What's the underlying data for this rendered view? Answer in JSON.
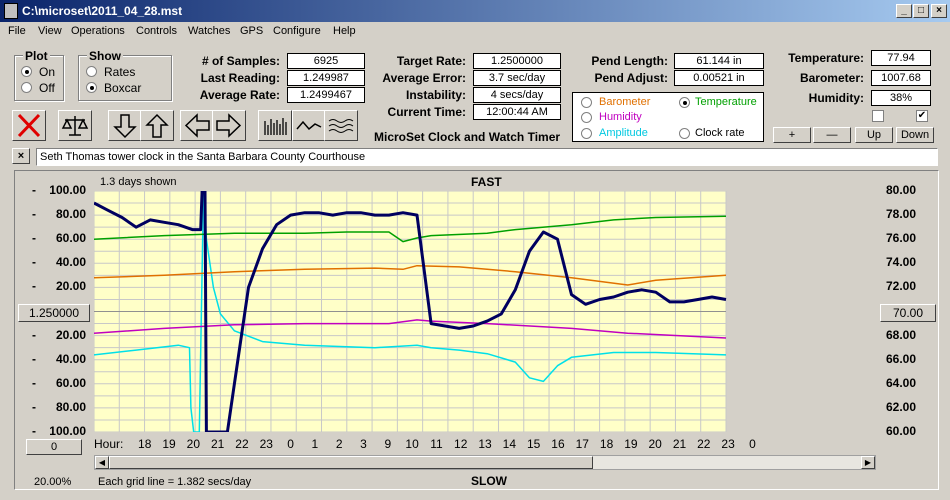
{
  "window": {
    "title": "C:\\microset\\2011_04_28.mst",
    "minimize": "_",
    "maximize": "□",
    "close": "×"
  },
  "menu": [
    "File",
    "View",
    "Operations",
    "Controls",
    "Watches",
    "GPS",
    "Configure",
    "Help"
  ],
  "plot_group": {
    "title": "Plot",
    "on": "On",
    "off": "Off",
    "selected": "On"
  },
  "show_group": {
    "title": "Show",
    "rates": "Rates",
    "boxcar": "Boxcar",
    "selected": "Boxcar"
  },
  "stats": {
    "samples_label": "# of Samples:",
    "samples": "6925",
    "last_label": "Last Reading:",
    "last": "1.249987",
    "avg_label": "Average Rate:",
    "avg": "1.2499467",
    "target_label": "Target Rate:",
    "target": "1.2500000",
    "error_label": "Average Error:",
    "error": "3.7 sec/day",
    "instab_label": "Instability:",
    "instab": "4 secs/day",
    "time_label": "Current Time:",
    "time": "12:00:44 AM",
    "pend_len_label": "Pend Length:",
    "pend_len": "61.144 in",
    "pend_adj_label": "Pend Adjust:",
    "pend_adj": "0.00521 in",
    "temp_label": "Temperature:",
    "temp": "77.94",
    "baro_label": "Barometer:",
    "baro": "1007.68",
    "hum_label": "Humidity:",
    "hum": "38%"
  },
  "app_name": "MicroSet Clock and Watch Timer",
  "legend": {
    "barometer": {
      "label": "Barometer",
      "color": "#e07000"
    },
    "temperature": {
      "label": "Temperature",
      "color": "#00a000",
      "selected": true
    },
    "humidity": {
      "label": "Humidity",
      "color": "#c000c0"
    },
    "amplitude": {
      "label": "Amplitude",
      "color": "#00c8e0"
    },
    "clock_rate": {
      "label": "Clock rate",
      "color": "#000000"
    }
  },
  "scale_buttons": {
    "plus": "+",
    "minus": "—",
    "up": "Up",
    "down": "Down"
  },
  "description_close": "×",
  "description": "Seth Thomas tower clock in the Santa Barbara County Courthouse",
  "chart_header": {
    "days_shown": "1.3 days shown",
    "fast": "FAST",
    "slow": "SLOW"
  },
  "center_left_button": "1.250000",
  "center_right_button": "70.00",
  "zero_button": "0",
  "hour_label": "Hour:",
  "footer": {
    "zoom": "20.00%",
    "grid_note": "Each grid line = 1.382 secs/day"
  },
  "chart_data": {
    "type": "line",
    "x_unit": "hour",
    "x_ticks": [
      "18",
      "19",
      "20",
      "21",
      "22",
      "23",
      "0",
      "1",
      "2",
      "3",
      "9",
      "10",
      "11",
      "12",
      "13",
      "14",
      "15",
      "16",
      "17",
      "18",
      "19",
      "20",
      "21",
      "22",
      "23",
      "0"
    ],
    "left_axis": {
      "ticks": [
        "100.00",
        "80.00",
        "60.00",
        "40.00",
        "20.00",
        "",
        "20.00",
        "40.00",
        "60.00",
        "80.00",
        "100.00"
      ],
      "ylim": [
        -100,
        100
      ]
    },
    "right_axis": {
      "ticks": [
        "80.00",
        "78.00",
        "76.00",
        "74.00",
        "72.00",
        "70.00",
        "68.00",
        "66.00",
        "64.00",
        "62.00",
        "60.00"
      ],
      "ylim": [
        60,
        80
      ]
    },
    "grid": true,
    "series": [
      {
        "key": "clock_rate",
        "color": "#000060",
        "values": [
          [
            0,
            90
          ],
          [
            1,
            84
          ],
          [
            2,
            78
          ],
          [
            3,
            70
          ],
          [
            4,
            76
          ],
          [
            5,
            74
          ],
          [
            6,
            72
          ],
          [
            7,
            68
          ],
          [
            7.6,
            68
          ],
          [
            7.7,
            100
          ],
          [
            7.9,
            100
          ],
          [
            8.0,
            -100
          ],
          [
            8.5,
            -100
          ],
          [
            9,
            -100
          ],
          [
            9.5,
            -100
          ],
          [
            10,
            -60
          ],
          [
            11,
            20
          ],
          [
            12,
            52
          ],
          [
            13,
            72
          ],
          [
            14,
            80
          ],
          [
            15,
            82
          ],
          [
            16,
            82
          ],
          [
            17,
            80
          ],
          [
            18,
            82
          ],
          [
            19,
            82
          ],
          [
            20,
            80
          ],
          [
            21,
            80
          ],
          [
            22,
            82
          ],
          [
            23,
            80
          ],
          [
            24,
            -10
          ],
          [
            25,
            -12
          ],
          [
            26,
            -14
          ],
          [
            27,
            -12
          ],
          [
            28,
            -8
          ],
          [
            29,
            -2
          ],
          [
            30,
            18
          ],
          [
            31,
            50
          ],
          [
            32,
            66
          ],
          [
            33,
            60
          ],
          [
            34,
            14
          ],
          [
            35,
            6
          ],
          [
            36,
            10
          ],
          [
            37,
            12
          ],
          [
            38,
            16
          ],
          [
            39,
            18
          ],
          [
            40,
            16
          ],
          [
            41,
            8
          ],
          [
            42,
            8
          ],
          [
            43,
            10
          ],
          [
            44,
            12
          ],
          [
            45,
            10
          ]
        ]
      },
      {
        "key": "temperature",
        "color": "#00a000",
        "values": [
          [
            0,
            76.0
          ],
          [
            5,
            76.3
          ],
          [
            10,
            76.5
          ],
          [
            15,
            76.5
          ],
          [
            18,
            76.6
          ],
          [
            21,
            76.6
          ],
          [
            22,
            75.8
          ],
          [
            23,
            76.1
          ],
          [
            24,
            76.3
          ],
          [
            28,
            76.5
          ],
          [
            30,
            76.8
          ],
          [
            34,
            77.2
          ],
          [
            37,
            77.6
          ],
          [
            40,
            77.8
          ],
          [
            45,
            77.9
          ]
        ]
      },
      {
        "key": "barometer",
        "color": "#e07000",
        "values": [
          [
            0,
            72.8
          ],
          [
            5,
            73.0
          ],
          [
            10,
            73.3
          ],
          [
            15,
            73.5
          ],
          [
            20,
            73.6
          ],
          [
            22,
            73.5
          ],
          [
            23,
            73.8
          ],
          [
            26,
            73.7
          ],
          [
            30,
            73.3
          ],
          [
            34,
            72.8
          ],
          [
            38,
            72.2
          ],
          [
            40,
            72.6
          ],
          [
            45,
            73.0
          ]
        ]
      },
      {
        "key": "humidity",
        "color": "#c000c0",
        "values": [
          [
            0,
            68.2
          ],
          [
            5,
            68.6
          ],
          [
            10,
            68.9
          ],
          [
            15,
            69.0
          ],
          [
            21,
            69.0
          ],
          [
            23,
            69.3
          ],
          [
            24,
            69.2
          ],
          [
            28,
            69.0
          ],
          [
            34,
            68.6
          ],
          [
            38,
            68.2
          ],
          [
            45,
            67.8
          ]
        ]
      },
      {
        "key": "amplitude",
        "color": "#00e0e8",
        "values": [
          [
            0,
            66.4
          ],
          [
            3,
            66.8
          ],
          [
            6,
            67.2
          ],
          [
            6.8,
            67.0
          ],
          [
            6.9,
            62.0
          ],
          [
            7.1,
            60.0
          ],
          [
            7.5,
            60.0
          ],
          [
            7.8,
            80.0
          ],
          [
            8.0,
            76.0
          ],
          [
            8.5,
            72.0
          ],
          [
            9,
            69.8
          ],
          [
            10,
            68.4
          ],
          [
            12,
            67.5
          ],
          [
            15,
            67.2
          ],
          [
            20,
            67.0
          ],
          [
            23,
            67.2
          ],
          [
            24,
            67.0
          ],
          [
            26,
            66.8
          ],
          [
            28,
            66.5
          ],
          [
            30,
            65.8
          ],
          [
            31,
            64.5
          ],
          [
            32,
            64.2
          ],
          [
            33,
            65.5
          ],
          [
            34,
            66.2
          ],
          [
            37,
            66.6
          ],
          [
            40,
            66.6
          ],
          [
            45,
            66.4
          ]
        ]
      }
    ]
  }
}
